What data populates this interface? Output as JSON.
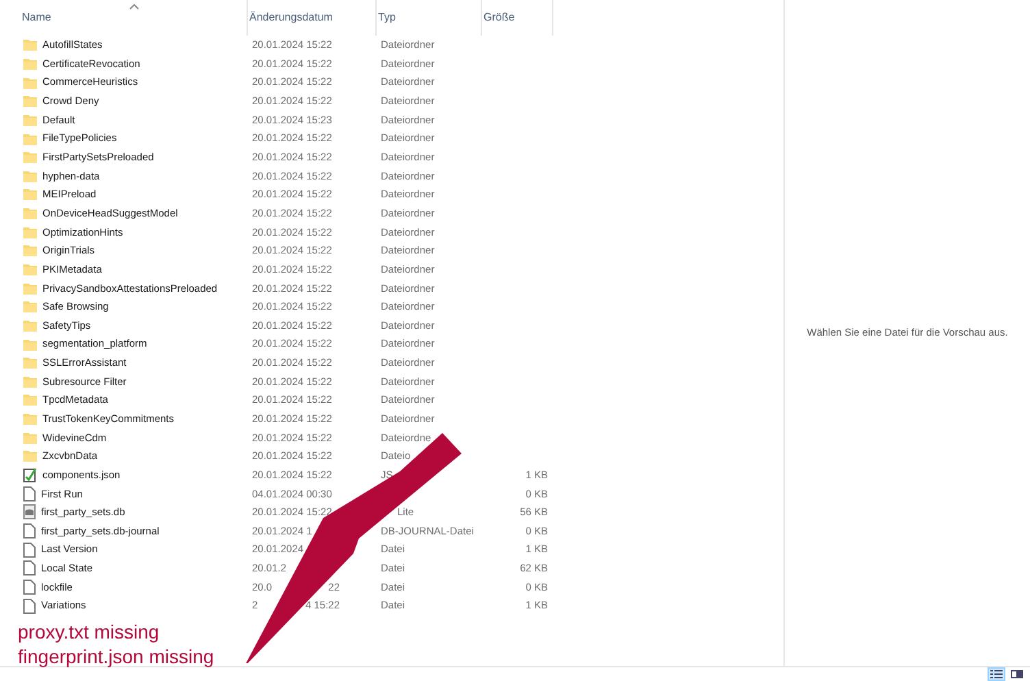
{
  "columns": [
    {
      "label": "Name",
      "sorted": true
    },
    {
      "label": "Änderungsdatum",
      "sorted": false
    },
    {
      "label": "Typ",
      "sorted": false
    },
    {
      "label": "Größe",
      "sorted": false
    }
  ],
  "rows": [
    {
      "kind": "folder",
      "name": "AutofillStates",
      "date": "20.01.2024 15:22",
      "type": "Dateiordner"
    },
    {
      "kind": "folder",
      "name": "CertificateRevocation",
      "date": "20.01.2024 15:22",
      "type": "Dateiordner"
    },
    {
      "kind": "folder",
      "name": "CommerceHeuristics",
      "date": "20.01.2024 15:22",
      "type": "Dateiordner"
    },
    {
      "kind": "folder",
      "name": "Crowd Deny",
      "date": "20.01.2024 15:22",
      "type": "Dateiordner"
    },
    {
      "kind": "folder",
      "name": "Default",
      "date": "20.01.2024 15:23",
      "type": "Dateiordner"
    },
    {
      "kind": "folder",
      "name": "FileTypePolicies",
      "date": "20.01.2024 15:22",
      "type": "Dateiordner"
    },
    {
      "kind": "folder",
      "name": "FirstPartySetsPreloaded",
      "date": "20.01.2024 15:22",
      "type": "Dateiordner"
    },
    {
      "kind": "folder",
      "name": "hyphen-data",
      "date": "20.01.2024 15:22",
      "type": "Dateiordner"
    },
    {
      "kind": "folder",
      "name": "MEIPreload",
      "date": "20.01.2024 15:22",
      "type": "Dateiordner"
    },
    {
      "kind": "folder",
      "name": "OnDeviceHeadSuggestModel",
      "date": "20.01.2024 15:22",
      "type": "Dateiordner"
    },
    {
      "kind": "folder",
      "name": "OptimizationHints",
      "date": "20.01.2024 15:22",
      "type": "Dateiordner"
    },
    {
      "kind": "folder",
      "name": "OriginTrials",
      "date": "20.01.2024 15:22",
      "type": "Dateiordner"
    },
    {
      "kind": "folder",
      "name": "PKIMetadata",
      "date": "20.01.2024 15:22",
      "type": "Dateiordner"
    },
    {
      "kind": "folder",
      "name": "PrivacySandboxAttestationsPreloaded",
      "date": "20.01.2024 15:22",
      "type": "Dateiordner"
    },
    {
      "kind": "folder",
      "name": "Safe Browsing",
      "date": "20.01.2024 15:22",
      "type": "Dateiordner"
    },
    {
      "kind": "folder",
      "name": "SafetyTips",
      "date": "20.01.2024 15:22",
      "type": "Dateiordner"
    },
    {
      "kind": "folder",
      "name": "segmentation_platform",
      "date": "20.01.2024 15:22",
      "type": "Dateiordner"
    },
    {
      "kind": "folder",
      "name": "SSLErrorAssistant",
      "date": "20.01.2024 15:22",
      "type": "Dateiordner"
    },
    {
      "kind": "folder",
      "name": "Subresource Filter",
      "date": "20.01.2024 15:22",
      "type": "Dateiordner"
    },
    {
      "kind": "folder",
      "name": "TpcdMetadata",
      "date": "20.01.2024 15:22",
      "type": "Dateiordner"
    },
    {
      "kind": "folder",
      "name": "TrustTokenKeyCommitments",
      "date": "20.01.2024 15:22",
      "type": "Dateiordner"
    },
    {
      "kind": "folder",
      "name": "WidevineCdm",
      "date": "20.01.2024 15:22",
      "type": "Dateiordne"
    },
    {
      "kind": "folder",
      "name": "ZxcvbnData",
      "date": "20.01.2024 15:22",
      "type": "Dateio"
    },
    {
      "kind": "json",
      "name": "components.json",
      "date": "20.01.2024 15:22",
      "type": "JS",
      "size": "1 KB"
    },
    {
      "kind": "file",
      "name": "First Run",
      "date": "04.01.2024 00:30",
      "size": "0 KB"
    },
    {
      "kind": "db",
      "name": "first_party_sets.db",
      "date": "20.01.2024 15:22",
      "type_tail": "Lite",
      "size": "56 KB"
    },
    {
      "kind": "file",
      "name": "first_party_sets.db-journal",
      "date": "20.01.2024 1",
      "type": "DB-JOURNAL-Datei",
      "size": "0 KB"
    },
    {
      "kind": "file",
      "name": "Last Version",
      "date": "20.01.2024",
      "type": "Datei",
      "size": "1 KB"
    },
    {
      "kind": "file",
      "name": "Local State",
      "date": "20.01.2",
      "type": "Datei",
      "size": "62 KB"
    },
    {
      "kind": "file",
      "name": "lockfile",
      "date": "20.0",
      "date_tail": "22",
      "type": "Datei",
      "size": "0 KB"
    },
    {
      "kind": "file",
      "name": "Variations",
      "date": "2",
      "date_tail": "4 15:22",
      "type": "Datei",
      "size": "1 KB"
    }
  ],
  "annotations": [
    "proxy.txt missing",
    "fingerprint.json missing"
  ],
  "preview_message": "Wählen Sie eine Datei für die Vorschau aus.",
  "view_buttons": [
    {
      "kind": "details",
      "selected": true
    },
    {
      "kind": "tiles",
      "selected": false
    }
  ]
}
